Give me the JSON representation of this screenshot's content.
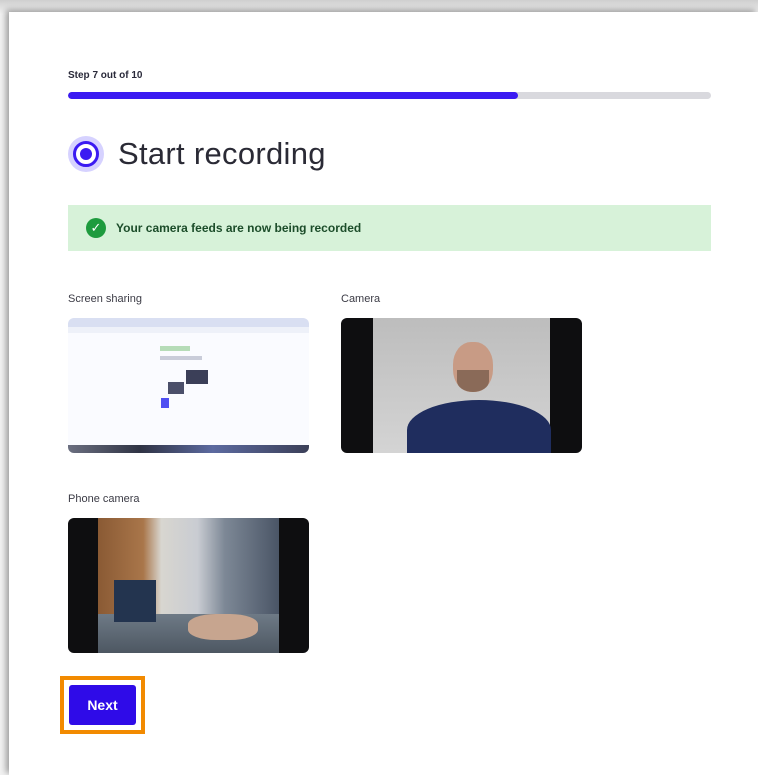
{
  "progress": {
    "step_text": "Step 7 out of 10",
    "value_fraction": 0.7
  },
  "title": "Start recording",
  "banner": {
    "message": "Your camera feeds are now being recorded",
    "icon": "check-circle-icon"
  },
  "feeds": {
    "screen_sharing_label": "Screen sharing",
    "camera_label": "Camera",
    "phone_camera_label": "Phone camera"
  },
  "next_button_label": "Next",
  "colors": {
    "accent": "#3b1bf2",
    "success_bg": "#d7f2d9",
    "success_icon": "#1e9b3e",
    "highlight": "#f28a00"
  }
}
